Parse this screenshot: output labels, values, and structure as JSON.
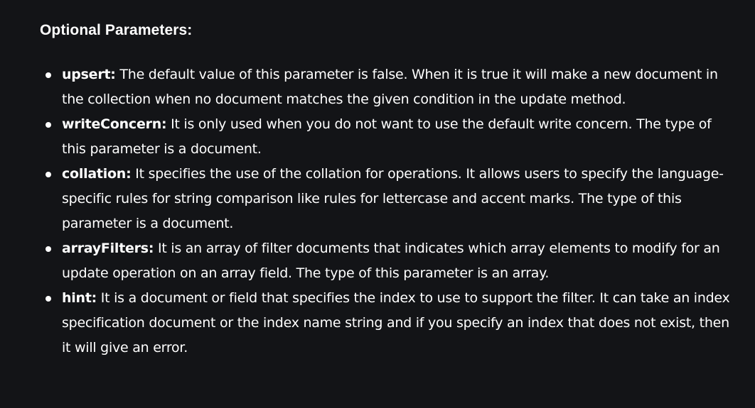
{
  "heading": "Optional Parameters:",
  "items": [
    {
      "term": "upsert:",
      "text": " The default value of this parameter is false. When it is true it will make a new document in the collection when no document matches the given condition in the update method."
    },
    {
      "term": "writeConcern:",
      "text": " It is only used when you do not want to use the default write concern. The type of this parameter is a document."
    },
    {
      "term": "collation:",
      "text": " It specifies the use of the collation for operations. It allows users to specify the language-specific rules for string comparison like rules for lettercase and accent marks. The type of this parameter is a document."
    },
    {
      "term": "arrayFilters:",
      "text": " It is an array of filter documents that indicates which array elements to modify for an update operation on an array field. The type of this parameter is an array."
    },
    {
      "term": "hint:",
      "text": " It is a document or field that specifies the index to use to support the filter. It can take an index specification document or the index name string and if you specify an index that does not exist, then it will give an error."
    }
  ]
}
